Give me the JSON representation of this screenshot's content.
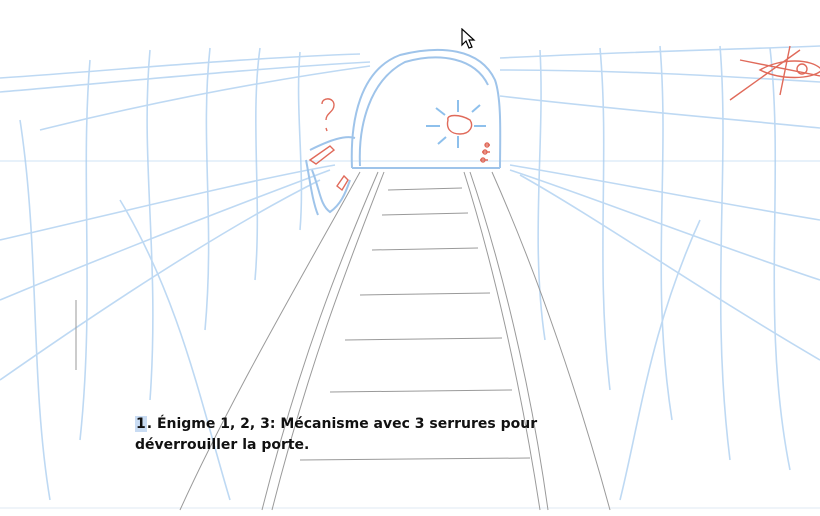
{
  "caption": {
    "number": "1",
    "line1": ". Énigme 1, 2, 3: Mécanisme avec 3 serrures pour",
    "line2": "déverrouiller la porte."
  },
  "icons": {
    "cursor": "mouse-pointer-icon",
    "question": "question-mark-sketch"
  },
  "colors": {
    "sketch_blue": "#a9cdf0",
    "sketch_grey": "#9a9a9a",
    "sketch_red": "#e06a5a",
    "highlight": "#c9dcf3"
  }
}
